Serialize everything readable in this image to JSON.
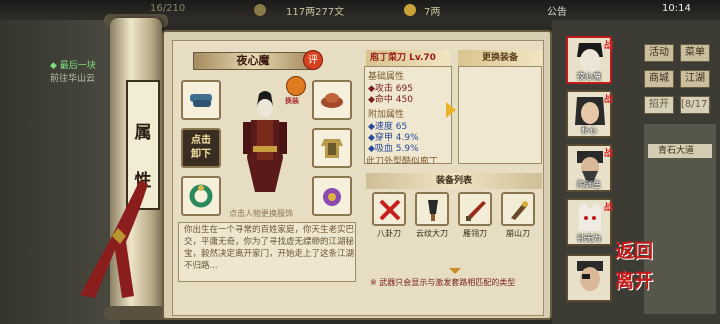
{
  "topbar": {
    "text1": "16/210",
    "currency": "117两277文",
    "taels": "7两",
    "announcement": "公告",
    "clock": "10:14"
  },
  "quest": {
    "line1": "◆ 最后一块",
    "line2": "前往华山云"
  },
  "left_tabs": {
    "tab1": "属",
    "tab2": "性"
  },
  "character": {
    "name": "夜心魔",
    "badge": "评",
    "switch_label": "换装",
    "unequip_label": "点击\n卸下",
    "hint": "点击人物更换服饰",
    "description": "你出生在一个寻常的百姓家庭，你天生老实巴交，平庸无奇，你为了寻找虚无缥缈的江湖秘宝，毅然决定离开家门，开始走上了这条江湖不归路..."
  },
  "weapon": {
    "title": "庖丁菜刀 Lv.70",
    "base_header": "基础属性",
    "base_stats": [
      "◆攻击  695",
      "◆命中  450"
    ],
    "extra_header": "附加属性",
    "extra_stats": [
      "◆速度  65",
      "◆穿甲  4.9%",
      "◆吸血  5.9%"
    ],
    "overflow_text": "此刀外型酷似庖丁"
  },
  "change_equipment": {
    "title": "更换装备"
  },
  "equipment_list": {
    "title": "装备列表",
    "items": [
      {
        "label": "八卦刀"
      },
      {
        "label": "云纹大刀"
      },
      {
        "label": "雁翎刀"
      },
      {
        "label": "崩山刀"
      }
    ],
    "note": "※ 武器只会显示与激发套路相匹配的类型"
  },
  "right_menu": {
    "buttons": [
      "活动",
      "菜单",
      "商城",
      "江湖",
      "招开",
      "[8/17]"
    ],
    "location": "青石大道"
  },
  "party": [
    {
      "name": "夜心魔",
      "tag": "战"
    },
    {
      "name": "朴心",
      "tag": "战"
    },
    {
      "name": "陶渊生",
      "tag": "战"
    },
    {
      "name": "钟无为",
      "tag": "战"
    },
    {
      "name": "",
      "tag": ""
    }
  ],
  "back_button": {
    "label_top": "返回",
    "label_bottom": "离开"
  },
  "colors": {
    "accent_red": "#c51a1a",
    "parchment": "#e6ddc3",
    "frame": "#6b5b3e"
  }
}
